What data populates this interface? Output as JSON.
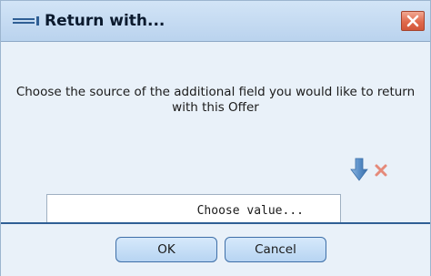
{
  "dialog": {
    "title": "Return with...",
    "message": "Choose the source of the additional field you would like to return with this Offer",
    "value_field": {
      "placeholder": "Choose value..."
    },
    "buttons": {
      "ok": "OK",
      "cancel": "Cancel"
    }
  },
  "icons": {
    "title": "return-arrow-icon",
    "close": "close-icon",
    "pick_value": "down-arrow-icon",
    "clear_value": "clear-x-icon"
  },
  "colors": {
    "accent": "#2f5f95",
    "close_button": "#e0694c",
    "arrow": "#5a8fc8"
  }
}
